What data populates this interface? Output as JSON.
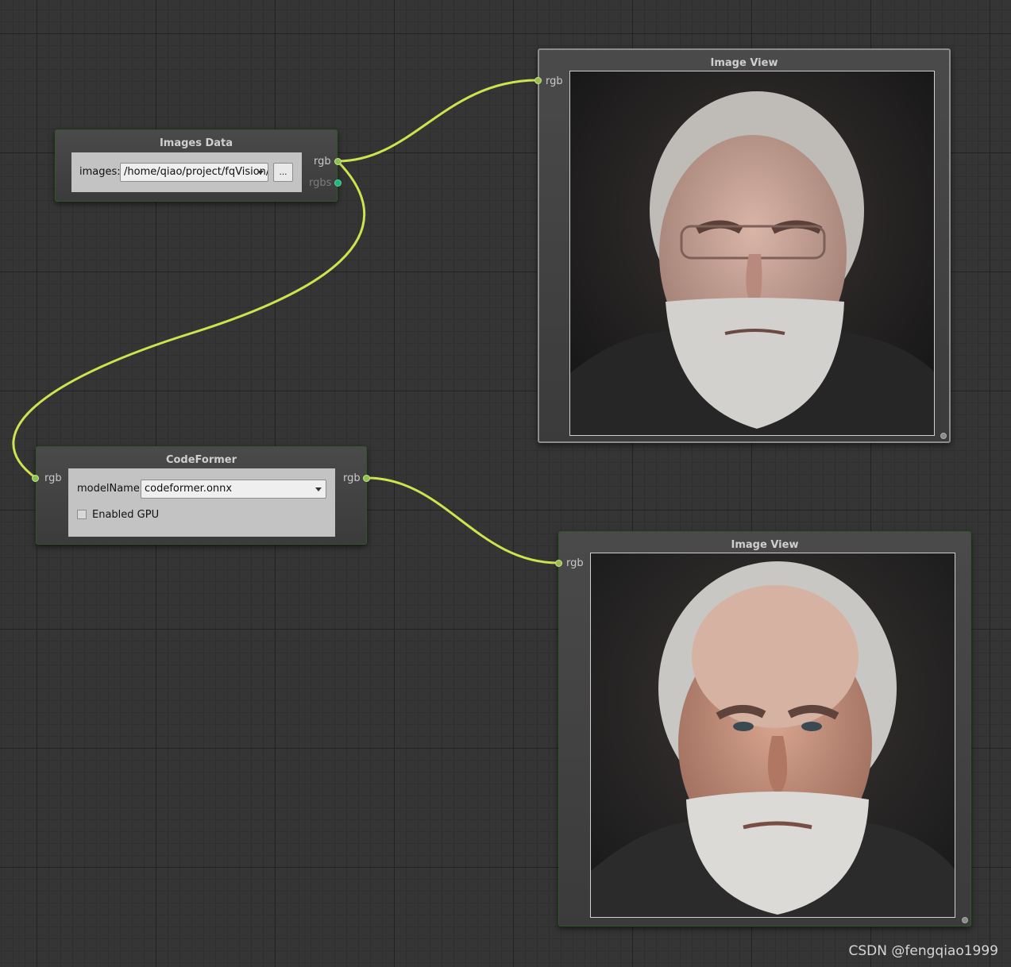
{
  "nodes": {
    "images_data": {
      "title": "Images Data",
      "images_label": "images:",
      "images_value": "/home/qiao/project/fqVision/",
      "browse_label": "...",
      "outputs": [
        "rgb",
        "rgbs"
      ]
    },
    "codeformer": {
      "title": "CodeFormer",
      "input": "rgb",
      "output": "rgb",
      "model_label": "modelName:",
      "model_value": "codeformer.onnx",
      "gpu_label": "Enabled GPU",
      "gpu_checked": false
    },
    "image_view_1": {
      "title": "Image View",
      "input": "rgb",
      "image": "old-man-portrait-low-quality"
    },
    "image_view_2": {
      "title": "Image View",
      "input": "rgb",
      "image": "old-man-portrait-restored"
    }
  },
  "colors": {
    "wire": "#cfe34f",
    "port_rgb": "#8bc34a",
    "port_rgbs": "#21b57a",
    "node_border": "#2d5a23"
  },
  "watermark": "CSDN @fengqiao1999"
}
